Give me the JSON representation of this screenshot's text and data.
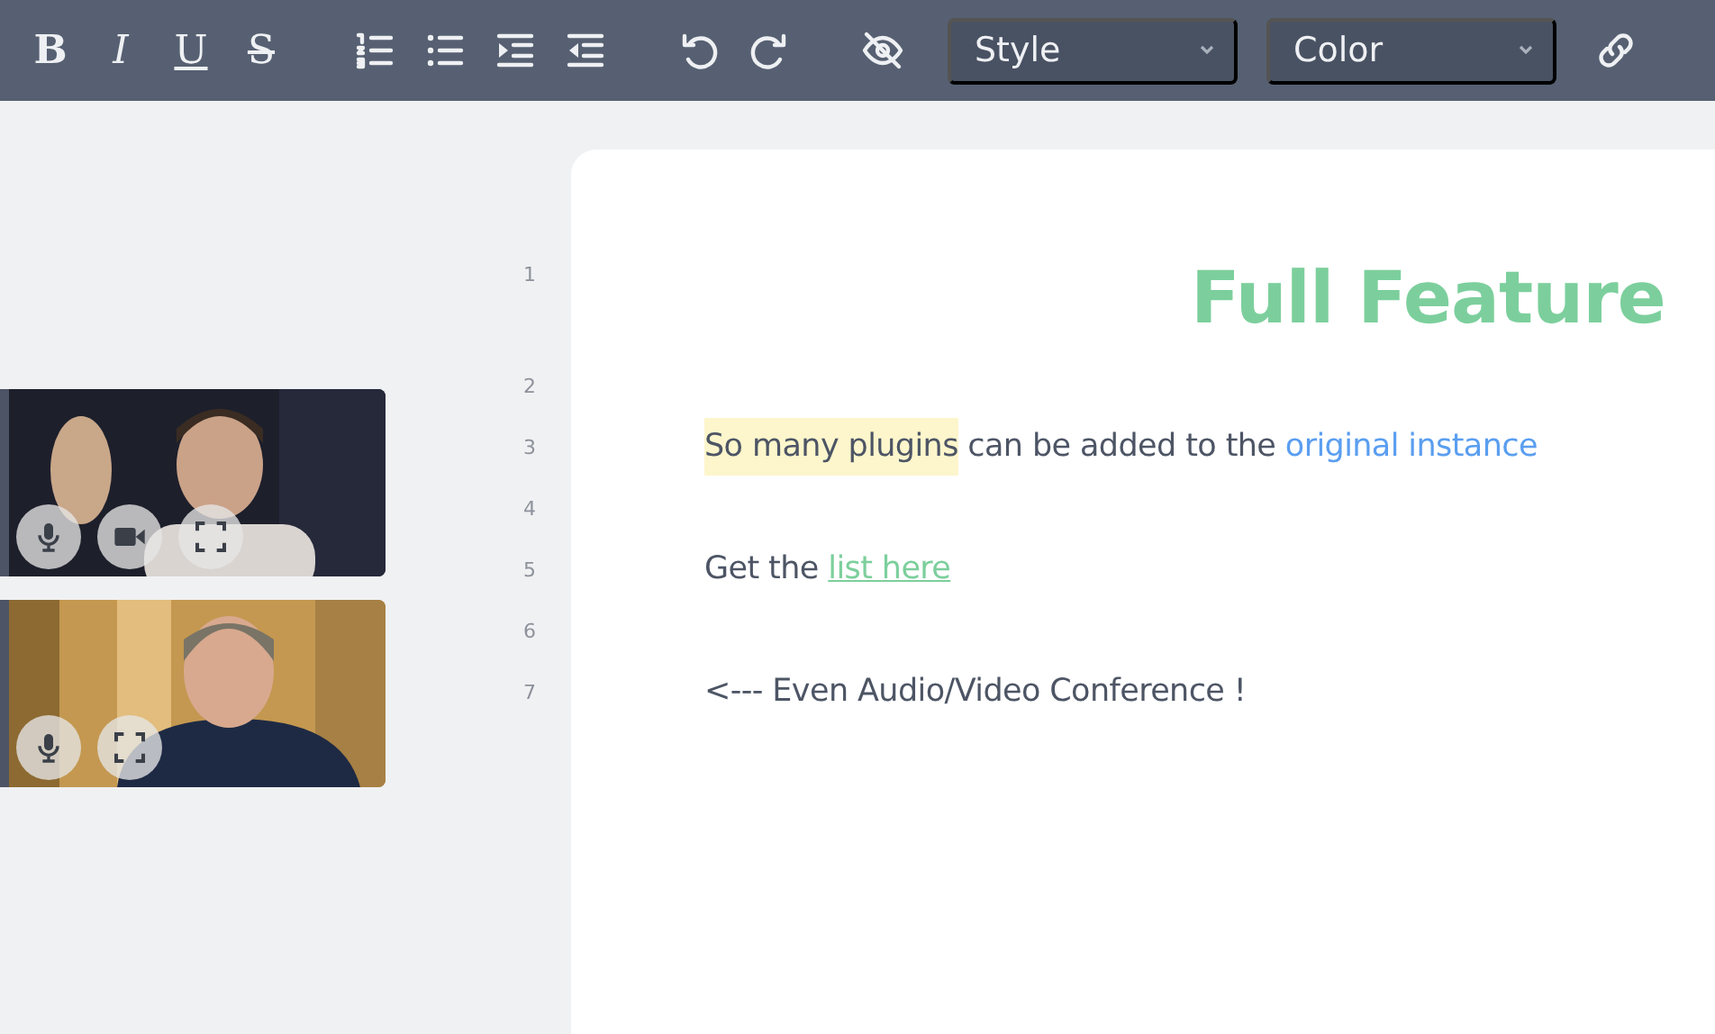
{
  "toolbar": {
    "buttons": [
      {
        "kind": "bold",
        "label": "B"
      },
      {
        "kind": "italic",
        "label": "I"
      },
      {
        "kind": "underline",
        "label": "U"
      },
      {
        "kind": "strike",
        "label": "S"
      },
      {
        "kind": "ordered-list"
      },
      {
        "kind": "bullet-list"
      },
      {
        "kind": "indent"
      },
      {
        "kind": "outdent"
      },
      {
        "kind": "undo"
      },
      {
        "kind": "redo"
      },
      {
        "kind": "hide"
      }
    ],
    "dropdowns": [
      {
        "label": "Style"
      },
      {
        "label": "Color"
      }
    ],
    "trailing": [
      {
        "kind": "link"
      }
    ]
  },
  "videos": [
    {
      "kind": "picture",
      "controls": [
        {
          "kind": "mic"
        },
        {
          "kind": "camera"
        },
        {
          "kind": "fullscreen"
        }
      ]
    },
    {
      "kind": "picture",
      "controls": [
        {
          "kind": "mic"
        },
        {
          "kind": "fullscreen"
        }
      ]
    }
  ],
  "lines": [
    {
      "number": "1",
      "kind": "heading",
      "segments": [
        {
          "kind": "plain",
          "text": "Full Feature"
        }
      ]
    },
    {
      "number": "2",
      "kind": "empty"
    },
    {
      "number": "3",
      "kind": "paragraph",
      "segments": [
        {
          "kind": "highlight",
          "text": "So many plugins"
        },
        {
          "kind": "plain",
          "text": " can be added to the "
        },
        {
          "kind": "link",
          "text": "original instance"
        }
      ]
    },
    {
      "number": "4",
      "kind": "empty"
    },
    {
      "number": "5",
      "kind": "paragraph",
      "segments": [
        {
          "kind": "plain",
          "text": "Get the "
        },
        {
          "kind": "underline-link",
          "text": "list here"
        }
      ]
    },
    {
      "number": "6",
      "kind": "empty"
    },
    {
      "number": "7",
      "kind": "paragraph",
      "segments": [
        {
          "kind": "plain",
          "text": "<--- Even Audio/Video Conference !"
        }
      ]
    }
  ]
}
